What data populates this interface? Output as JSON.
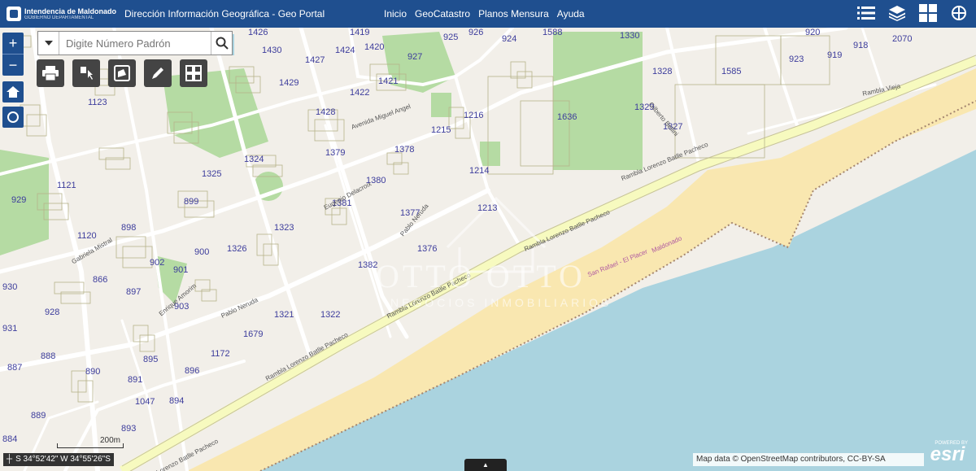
{
  "header": {
    "org_name": "Intendencia de Maldonado",
    "org_sub": "GOBIERNO DEPARTAMENTAL",
    "title": "Dirección Información Geográfica - Geo Portal",
    "nav": [
      "Inicio",
      "GeoCatastro",
      "Planos Mensura",
      "Ayuda"
    ],
    "icons": [
      "list-icon",
      "layers-icon",
      "grid-icon",
      "map-share-icon"
    ]
  },
  "search": {
    "placeholder": "Digite Número Padrón"
  },
  "zoom": {
    "in": "+",
    "out": "−"
  },
  "tools": [
    "print-icon",
    "identify-icon",
    "measure-area-icon",
    "draw-icon",
    "basemap-icon"
  ],
  "attribution": "Map data © OpenStreetMap contributors, CC-BY-SA",
  "esri": {
    "powered": "POWERED BY",
    "brand": "esri"
  },
  "coords": {
    "text": "S 34°52'42\" W 34°55'26\"S"
  },
  "scale": "200m",
  "watermark": {
    "main": "OTTO OTTO",
    "sub": "NEGOCIOS INMOBILIARIOS"
  },
  "colors": {
    "header": "#1f4f8f",
    "sea": "#aad3df",
    "beach": "#f9e7b0",
    "land": "#f2efe9",
    "green": "#b5dba3",
    "road": "#ffffff",
    "parcel": "#b6b38a",
    "lot_label": "#3d3d9c"
  },
  "lots": [
    {
      "label": "1426"
    },
    {
      "label": "1430"
    },
    {
      "label": "1419"
    },
    {
      "label": "925"
    },
    {
      "label": "926"
    },
    {
      "label": "924"
    },
    {
      "label": "1588"
    },
    {
      "label": "1330"
    },
    {
      "label": "920"
    },
    {
      "label": "2070"
    },
    {
      "label": "1427"
    },
    {
      "label": "1424"
    },
    {
      "label": "1420"
    },
    {
      "label": "927"
    },
    {
      "label": "919"
    },
    {
      "label": "918"
    },
    {
      "label": "1585"
    },
    {
      "label": "1328"
    },
    {
      "label": "923"
    },
    {
      "label": "1429"
    },
    {
      "label": "1421"
    },
    {
      "label": "1422"
    },
    {
      "label": "1123"
    },
    {
      "label": "1428"
    },
    {
      "label": "1216"
    },
    {
      "label": "1636"
    },
    {
      "label": "1329"
    },
    {
      "label": "1327"
    },
    {
      "label": "1215"
    },
    {
      "label": "1379"
    },
    {
      "label": "1378"
    },
    {
      "label": "1324"
    },
    {
      "label": "1325"
    },
    {
      "label": "1380"
    },
    {
      "label": "1214"
    },
    {
      "label": "929"
    },
    {
      "label": "1121"
    },
    {
      "label": "899"
    },
    {
      "label": "1381"
    },
    {
      "label": "1377"
    },
    {
      "label": "1213"
    },
    {
      "label": "898"
    },
    {
      "label": "1323"
    },
    {
      "label": "1120"
    },
    {
      "label": "900"
    },
    {
      "label": "1326"
    },
    {
      "label": "1376"
    },
    {
      "label": "902"
    },
    {
      "label": "901"
    },
    {
      "label": "1382"
    },
    {
      "label": "866"
    },
    {
      "label": "930"
    },
    {
      "label": "897"
    },
    {
      "label": "903"
    },
    {
      "label": "928"
    },
    {
      "label": "1321"
    },
    {
      "label": "1322"
    },
    {
      "label": "931"
    },
    {
      "label": "1679"
    },
    {
      "label": "888"
    },
    {
      "label": "1172"
    },
    {
      "label": "895"
    },
    {
      "label": "887"
    },
    {
      "label": "890"
    },
    {
      "label": "896"
    },
    {
      "label": "891"
    },
    {
      "label": "1047"
    },
    {
      "label": "894"
    },
    {
      "label": "889"
    },
    {
      "label": "893"
    },
    {
      "label": "884"
    }
  ],
  "streets": [
    "Rambla Lorenzo Batlle Pacheco",
    "Rambla Lorenzo Batlle Pacheco",
    "Rambla Lorenzo Batlle Pacheco",
    "Rambla Lorenzo Batlle Pacheco",
    "Rambla Lorenzo Batlle Pacheco",
    "Rambla Vieja",
    "San Rafael - El Placer",
    "Maldonado",
    "Avenida Miguel Angel",
    "Gabriela Mistral",
    "Pablo Neruda",
    "Enrique Amorim",
    "Eugenio Delacroix",
    "Pablo Neruda",
    "Gilberto Bellini"
  ]
}
